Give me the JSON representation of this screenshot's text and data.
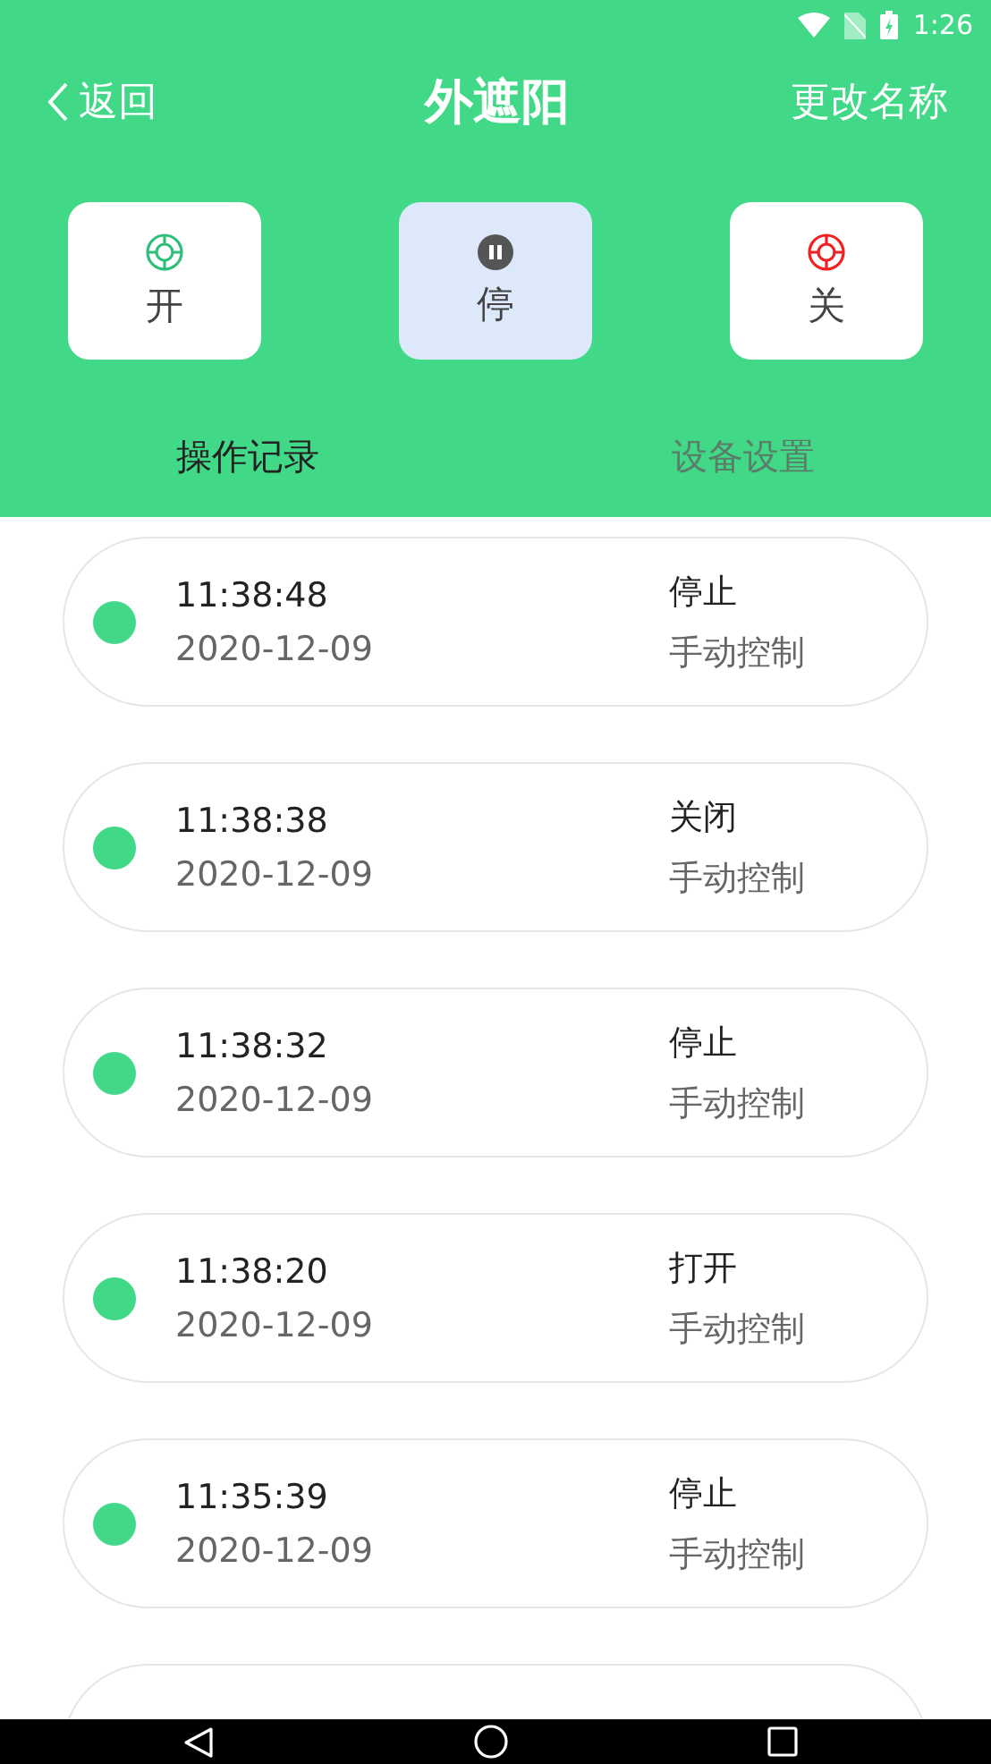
{
  "status_bar": {
    "time": "1:26"
  },
  "header": {
    "back": "返回",
    "title": "外遮阳",
    "rename": "更改名称"
  },
  "controls": [
    {
      "kind": "open",
      "label": "开",
      "selected": false
    },
    {
      "kind": "stop",
      "label": "停",
      "selected": true
    },
    {
      "kind": "close",
      "label": "关",
      "selected": false
    }
  ],
  "tabs": [
    {
      "label": "操作记录",
      "selected": true
    },
    {
      "label": "设备设置",
      "selected": false
    }
  ],
  "records": [
    {
      "time": "11:38:48",
      "date": "2020-12-09",
      "action": "停止",
      "mode": "手动控制"
    },
    {
      "time": "11:38:38",
      "date": "2020-12-09",
      "action": "关闭",
      "mode": "手动控制"
    },
    {
      "time": "11:38:32",
      "date": "2020-12-09",
      "action": "停止",
      "mode": "手动控制"
    },
    {
      "time": "11:38:20",
      "date": "2020-12-09",
      "action": "打开",
      "mode": "手动控制"
    },
    {
      "time": "11:35:39",
      "date": "2020-12-09",
      "action": "停止",
      "mode": "手动控制"
    }
  ]
}
